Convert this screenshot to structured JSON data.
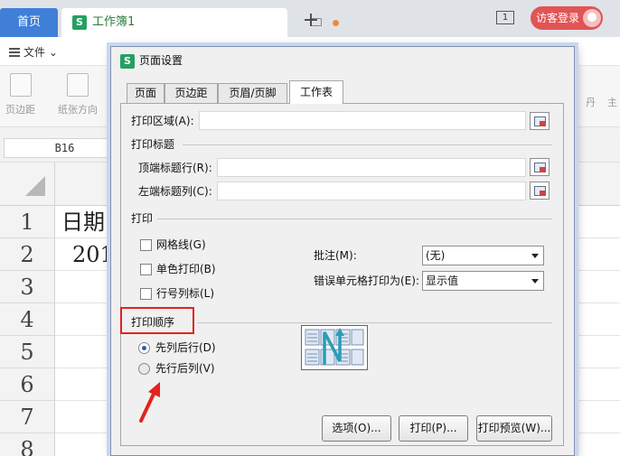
{
  "topbar": {
    "home_tab": "首页",
    "doc_tab": "工作簿1",
    "doc_icon": "S",
    "add_tab": "+",
    "window_count_badge": "1",
    "login_button": "访客登录"
  },
  "ribbon": {
    "file_menu": "文件",
    "items": [
      {
        "label": "页边距",
        "icon": "margins-icon"
      },
      {
        "label": "纸张方向",
        "icon": "orientation-icon"
      }
    ],
    "right_label_1": "丹",
    "right_label_2": "主"
  },
  "formula_bar": {
    "name_box": "B16"
  },
  "sheet": {
    "row_numbers": [
      "1",
      "2",
      "3",
      "4",
      "5",
      "6",
      "7",
      "8"
    ],
    "cells": {
      "r1": "日期",
      "r2": "201"
    }
  },
  "dialog": {
    "icon": "S",
    "title": "页面设置",
    "tabs": [
      "页面",
      "页边距",
      "页眉/页脚",
      "工作表"
    ],
    "active_tab_index": 3,
    "print_area_label": "打印区域(A):",
    "print_titles_section": "打印标题",
    "top_rows_label": "顶端标题行(R):",
    "left_cols_label": "左端标题列(C):",
    "print_section": "打印",
    "checkboxes": {
      "gridlines": "网格线(G)",
      "monochrome": "单色打印(B)",
      "row_col_headers": "行号列标(L)"
    },
    "comments_label": "批注(M):",
    "comments_value": "(无)",
    "errors_label": "错误单元格打印为(E):",
    "errors_value": "显示值",
    "print_order_section": "打印顺序",
    "radio_down_then_over": "先列后行(D)",
    "radio_over_then_down": "先行后列(V)",
    "selected_order": "先列后行(D)",
    "buttons": {
      "options": "选项(O)...",
      "print": "打印(P)...",
      "preview": "打印预览(W)..."
    }
  },
  "colors": {
    "home_tab": "#3f7fd7",
    "login_button": "#e25454",
    "highlight_box": "#e3231f",
    "annotation_arrow": "#e3231f",
    "order_arrow": "#2a9db6"
  }
}
